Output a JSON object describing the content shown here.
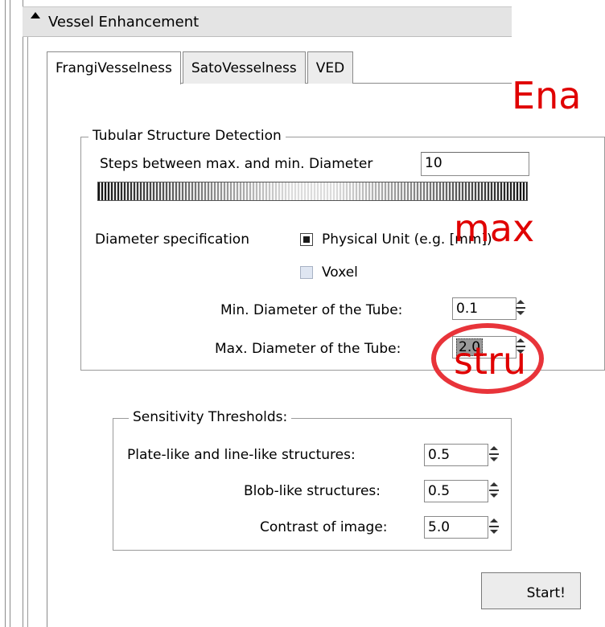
{
  "panel": {
    "title": "Vessel Enhancement"
  },
  "tabs": [
    {
      "label": "FrangiVesselness",
      "active": true
    },
    {
      "label": "SatoVesselness",
      "active": false
    },
    {
      "label": "VED",
      "active": false
    }
  ],
  "tubular": {
    "legend": "Tubular Structure Detection",
    "steps_label": "Steps between max. and min. Diameter",
    "steps_value": "10",
    "diameter_spec_label": "Diameter specification",
    "physical_label": "Physical Unit (e.g. [mm])",
    "voxel_label": "Voxel",
    "physical_selected": true,
    "min_label": "Min. Diameter of the Tube:",
    "min_value": "0.1",
    "max_label": "Max. Diameter of the Tube:",
    "max_value": "2.0"
  },
  "sensitivity": {
    "legend": "Sensitivity Thresholds:",
    "plate_label": "Plate-like and line-like structures:",
    "plate_value": "0.5",
    "blob_label": "Blob-like structures:",
    "blob_value": "0.5",
    "contrast_label": "Contrast of image:",
    "contrast_value": "5.0"
  },
  "start_label": "Start!",
  "annotation": {
    "lines": [
      "Ena",
      "max",
      "stru"
    ],
    "color": "#e00000",
    "ellipse_color": "#e8343a"
  }
}
